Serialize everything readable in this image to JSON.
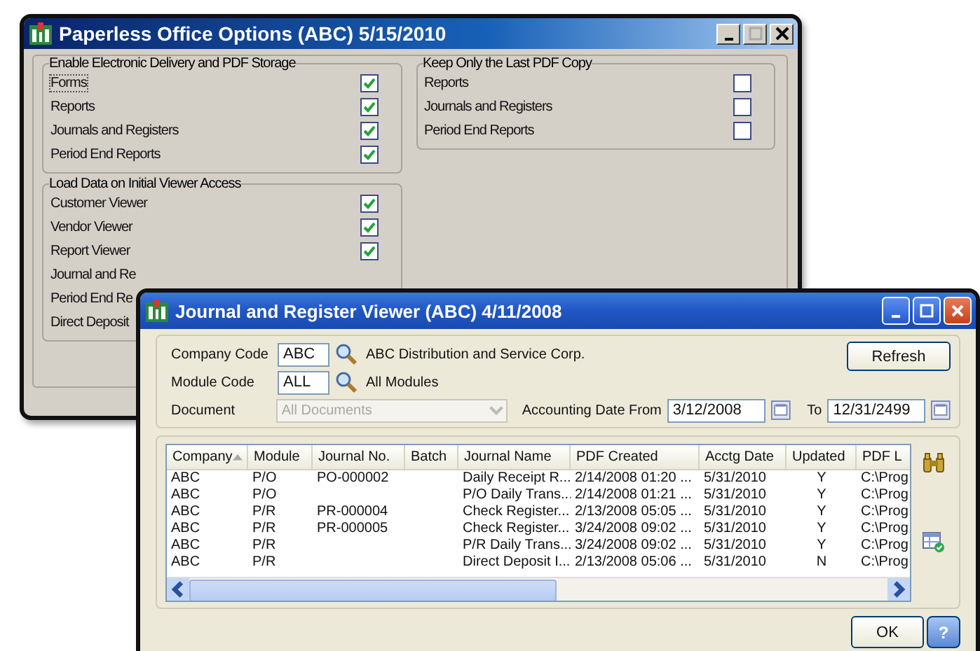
{
  "options_window": {
    "title": "Paperless Office Options (ABC) 5/15/2010",
    "enable_group": {
      "title": "Enable Electronic Delivery and PDF Storage",
      "items": [
        {
          "label": "Forms",
          "checked": true,
          "focused": true
        },
        {
          "label": "Reports",
          "checked": true,
          "focused": false
        },
        {
          "label": "Journals and Registers",
          "checked": true,
          "focused": false
        },
        {
          "label": "Period End Reports",
          "checked": true,
          "focused": false
        }
      ]
    },
    "keep_group": {
      "title": "Keep Only the Last PDF Copy",
      "items": [
        {
          "label": "Reports",
          "checked": false
        },
        {
          "label": "Journals and Registers",
          "checked": false
        },
        {
          "label": "Period End Reports",
          "checked": false
        }
      ]
    },
    "load_group": {
      "title": "Load Data on Initial Viewer Access",
      "items": [
        {
          "label": "Customer Viewer",
          "checked": true
        },
        {
          "label": "Vendor Viewer",
          "checked": true
        },
        {
          "label": "Report Viewer",
          "checked": true
        },
        {
          "label": "Journal and Re"
        },
        {
          "label": "Period End Re"
        },
        {
          "label": "Direct Deposit"
        }
      ]
    }
  },
  "viewer_window": {
    "title": "Journal and Register Viewer (ABC) 4/11/2008",
    "company_code": {
      "label": "Company Code",
      "value": "ABC",
      "description": "ABC Distribution and Service Corp."
    },
    "module_code": {
      "label": "Module Code",
      "value": "ALL",
      "description": "All Modules"
    },
    "document": {
      "label": "Document",
      "value": "All Documents",
      "disabled": true
    },
    "date_from": {
      "label": "Accounting Date From",
      "value": "3/12/2008"
    },
    "date_to": {
      "label": "To",
      "value": "12/31/2499"
    },
    "refresh_button": "Refresh",
    "table": {
      "columns": [
        {
          "label": "Company",
          "sorted": true
        },
        {
          "label": "Module",
          "sorted": false
        },
        {
          "label": "Journal No.",
          "sorted": false
        },
        {
          "label": "Batch",
          "sorted": false
        },
        {
          "label": "Journal Name",
          "sorted": false
        },
        {
          "label": "PDF Created",
          "sorted": false
        },
        {
          "label": "Acctg Date",
          "sorted": false
        },
        {
          "label": "Updated",
          "sorted": false
        },
        {
          "label": "PDF L",
          "sorted": false
        }
      ],
      "rows": [
        [
          "ABC",
          "P/O",
          "PO-000002",
          "",
          "Daily Receipt R...",
          "2/14/2008 01:20 ...",
          "5/31/2010",
          "Y",
          "C:\\Prog"
        ],
        [
          "ABC",
          "P/O",
          "",
          "",
          "P/O Daily Trans...",
          "2/14/2008 01:21 ...",
          "5/31/2010",
          "Y",
          "C:\\Prog"
        ],
        [
          "ABC",
          "P/R",
          "PR-000004",
          "",
          "Check Register...",
          "2/13/2008 05:05 ...",
          "5/31/2010",
          "Y",
          "C:\\Prog"
        ],
        [
          "ABC",
          "P/R",
          "PR-000005",
          "",
          "Check Register...",
          "3/24/2008 09:02 ...",
          "5/31/2010",
          "Y",
          "C:\\Prog"
        ],
        [
          "ABC",
          "P/R",
          "",
          "",
          "P/R Daily Trans...",
          "3/24/2008 09:02 ...",
          "5/31/2010",
          "Y",
          "C:\\Prog"
        ],
        [
          "ABC",
          "P/R",
          "",
          "",
          "Direct Deposit I...",
          "2/13/2008 05:06 ...",
          "5/31/2010",
          "N",
          "C:\\Prog"
        ]
      ]
    },
    "ok_button": "OK",
    "help_button": "?"
  }
}
